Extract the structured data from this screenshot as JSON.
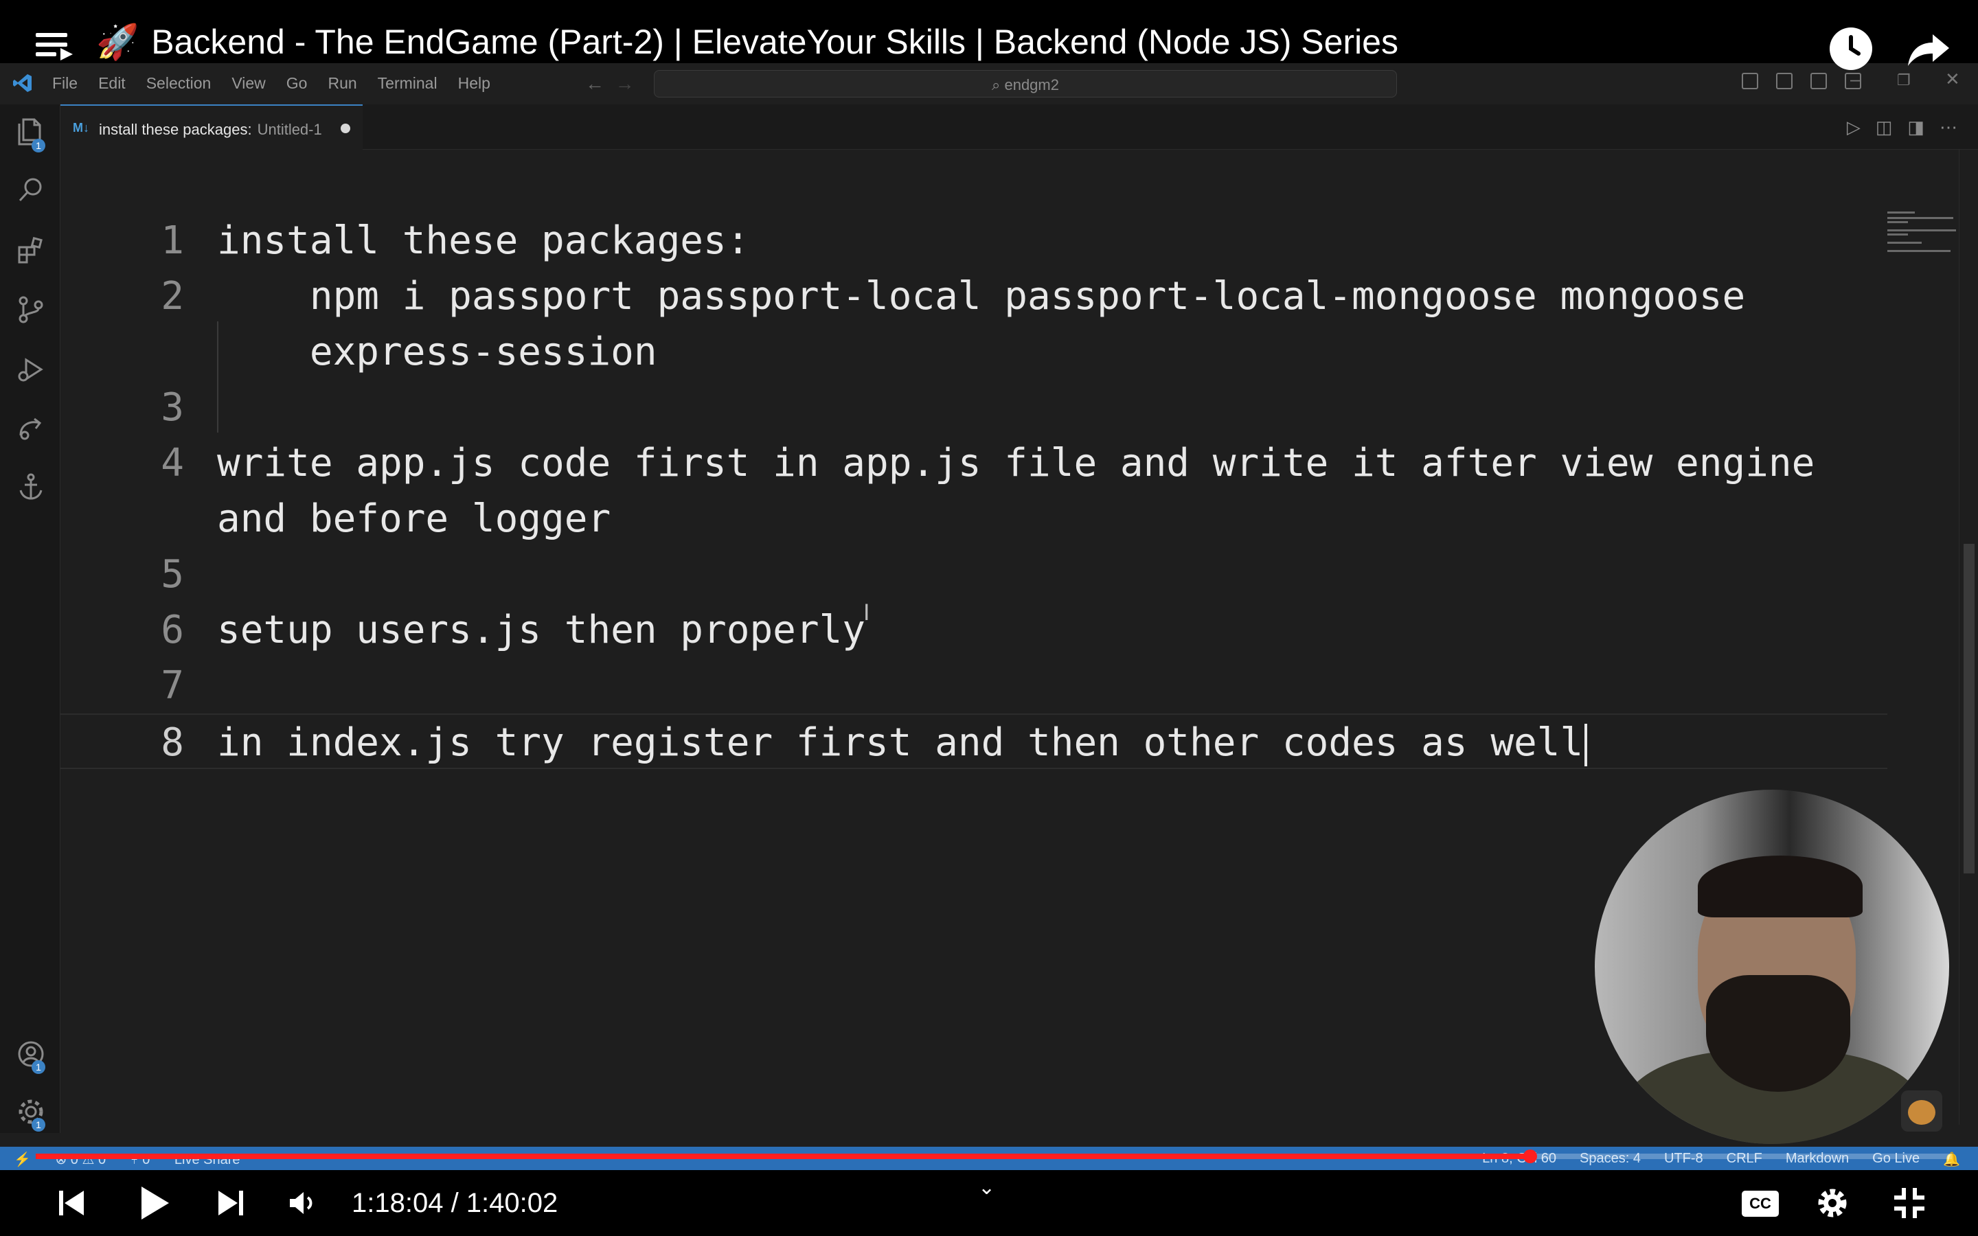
{
  "youtube": {
    "title_emoji": "🚀",
    "title": "Backend - The EndGame (Part-2) | ElevateYour Skills | Backend (Node JS) Series",
    "time": "1:18:04 / 1:40:02",
    "progress_fraction": 0.78,
    "cc_label": "CC"
  },
  "menu": {
    "file": "File",
    "edit": "Edit",
    "selection": "Selection",
    "view": "View",
    "go": "Go",
    "run": "Run",
    "terminal": "Terminal",
    "help": "Help"
  },
  "search": {
    "text": "endgm2"
  },
  "tab": {
    "icon": "M↓",
    "title": "install these packages:",
    "subtitle": "Untitled-1"
  },
  "editor": {
    "lines": [
      {
        "num": "1",
        "text": "install these packages:"
      },
      {
        "num": "2",
        "text": "    npm i passport passport-local passport-local-mongoose mongoose"
      },
      {
        "num": "",
        "text": "    express-session"
      },
      {
        "num": "3",
        "text": ""
      },
      {
        "num": "4",
        "text": "write app.js code first in app.js file and write it after view engine"
      },
      {
        "num": "",
        "text": "and before logger"
      },
      {
        "num": "5",
        "text": ""
      },
      {
        "num": "6",
        "text": "setup users.js then properly"
      },
      {
        "num": "7",
        "text": ""
      },
      {
        "num": "8",
        "text": "in index.js try register first and then other codes as well"
      }
    ]
  },
  "badges": {
    "explorer": "1",
    "accounts": "1",
    "settings": "1"
  },
  "statusbar": {
    "left_errors": "⊗ 0 ⚠ 0",
    "left_ports": "⑂ 0",
    "left_live": "Live Share",
    "position": "Ln 8, Col 60",
    "spaces": "Spaces: 4",
    "encoding": "UTF-8",
    "eol": "CRLF",
    "language": "Markdown",
    "golive": "Go Live"
  },
  "colors": {
    "statusbar": "#2b6fb7",
    "progress": "#ff1f1f",
    "editor_bg": "#1e1e1e"
  }
}
